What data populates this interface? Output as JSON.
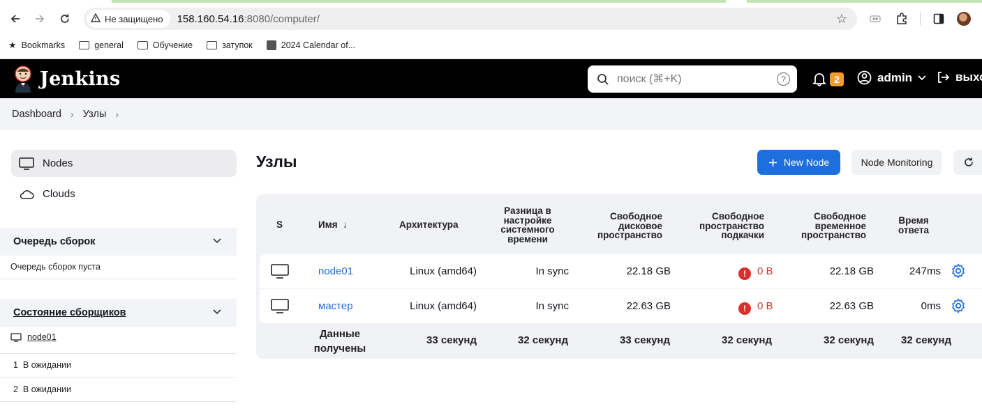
{
  "browser": {
    "security_label": "Не защищено",
    "url_host": "158.160.54.16",
    "url_rest": ":8080/computer/",
    "bookmarks": [
      "Bookmarks",
      "general",
      "Обучение",
      "затупок",
      "2024 Calendar of..."
    ]
  },
  "header": {
    "brand": "Jenkins",
    "search_placeholder": "поиск (⌘+K)",
    "notification_count": "2",
    "user": "admin",
    "logout": "выход"
  },
  "breadcrumb": [
    "Dashboard",
    "Узлы"
  ],
  "sidebar": {
    "items": [
      {
        "label": "Nodes",
        "icon": "computer-icon"
      },
      {
        "label": "Clouds",
        "icon": "cloud-icon"
      }
    ],
    "queue": {
      "title": "Очередь сборок",
      "empty_text": "Очередь сборок пуста"
    },
    "executors": {
      "title": "Состояние сборщиков",
      "node": "node01",
      "slots": [
        {
          "num": "1",
          "state": "В ожидании"
        },
        {
          "num": "2",
          "state": "В ожидании"
        }
      ]
    }
  },
  "main": {
    "title": "Узлы",
    "new_node": "New Node",
    "monitoring": "Node Monitoring"
  },
  "table": {
    "headers": {
      "s": "S",
      "name": "Имя",
      "sort_arrow": "↓",
      "arch": "Архитектура",
      "clock": [
        "Разница в",
        "настройке",
        "системного",
        "времени"
      ],
      "disk": [
        "Свободное",
        "дисковое",
        "пространство"
      ],
      "swap": [
        "Свободное",
        "пространство",
        "подкачки"
      ],
      "temp": [
        "Свободное",
        "временное",
        "пространство"
      ],
      "response": [
        "Время",
        "ответа"
      ]
    },
    "rows": [
      {
        "name": "node01",
        "arch": "Linux (amd64)",
        "clock": "In sync",
        "disk": "22.18 GB",
        "swap": "0 B",
        "temp": "22.18 GB",
        "response": "247ms"
      },
      {
        "name": "мастер",
        "arch": "Linux (amd64)",
        "clock": "In sync",
        "disk": "22.63 GB",
        "swap": "0 B",
        "temp": "22.63 GB",
        "response": "0ms"
      }
    ],
    "footer": {
      "label": [
        "Данные",
        "получены"
      ],
      "arch": "33 секунд",
      "clock": "32 секунд",
      "disk": "33 секунд",
      "swap": "32 секунд",
      "temp": "32 секунд",
      "response": "32 секунд"
    }
  },
  "colors": {
    "accent": "#1d6fdd",
    "badge": "#f39c2c",
    "error": "#d9302c",
    "header_bg": "#000000"
  }
}
